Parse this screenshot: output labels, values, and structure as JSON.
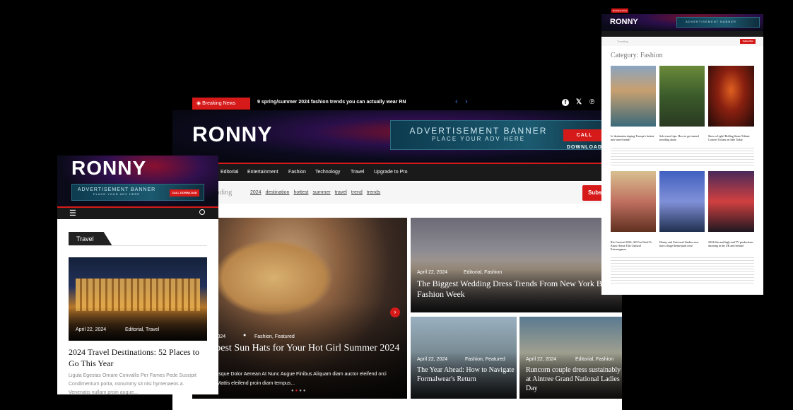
{
  "brand": {
    "logo": "RONNY",
    "accent": "#d61a1a",
    "dark": "#111111"
  },
  "ad": {
    "title": "ADVERTISEMENT BANNER",
    "sub": "PLACE YOUR ADV HERE",
    "btn": "CALL DOWNLOAD"
  },
  "main": {
    "breaking_label": "Breaking News",
    "breaking_text": "9 spring/summer 2024 fashion trends you can actually wear RN",
    "nav": [
      "Editorial",
      "Entertainment",
      "Fashion",
      "Technology",
      "Travel",
      "Upgrade to Pro"
    ],
    "trending_label": "Trending",
    "trending_tags": [
      "2024",
      "destination",
      "hottest",
      "summer",
      "travel",
      "trend",
      "trends"
    ],
    "subscribe": "Subscribe",
    "hero": {
      "date": "April 22, 2024",
      "cats": "Fashion, Featured",
      "title": "The best Sun Hats for Your Hot Girl Summer 2024",
      "excerpt": "Pellentesque Dolor Aenean At Nunc Augue Finibus Aliquam diam auctor eleifend orci ipsum. Mattis eleifend proin diam tempus..."
    },
    "card1": {
      "date": "April 22, 2024",
      "cats": "Editorial, Fashion",
      "title": "The Biggest Wedding Dress Trends From New York Bridal Fashion Week"
    },
    "card2": {
      "date": "April 22, 2024",
      "cats": "Fashion, Featured",
      "title": "The Year Ahead: How to Navigate Formalwear's Return"
    },
    "card3": {
      "date": "April 22, 2024",
      "cats": "Editorial, Fashion",
      "title": "Runcorn couple dress sustainably at Aintree Grand National Ladies Day"
    }
  },
  "mobile": {
    "section": "Travel",
    "date": "April 22, 2024",
    "cats": "Editorial, Travel",
    "title": "2024 Travel Destinations: 52 Places to Go This Year",
    "excerpt": "Ligula Egestas Ornare Convallis Per Fames Pede Suscipit Condimentum porta, nonummy sit nisi hymenaeos a. Venenatis nullam proin augue..."
  },
  "category_page": {
    "heading": "Category: Fashion",
    "row1": [
      {
        "title": "Is 'destination duping' Europe's hottest new travel trend?"
      },
      {
        "title": "Solo travel tips: How to get started traveling alone"
      },
      {
        "title": "Show a Light! Rolling Stone Tribute Concert Tickets on Sale Today"
      }
    ],
    "row2": [
      {
        "title": "Rio Carnival 2024: All You Need To Know About This Cultural Extravaganza"
      },
      {
        "title": "Disney and Universal Studios now have a huge theme-park rival"
      },
      {
        "title": "2024 film and high-end TV productions shooting in the UK and Ireland"
      }
    ]
  }
}
